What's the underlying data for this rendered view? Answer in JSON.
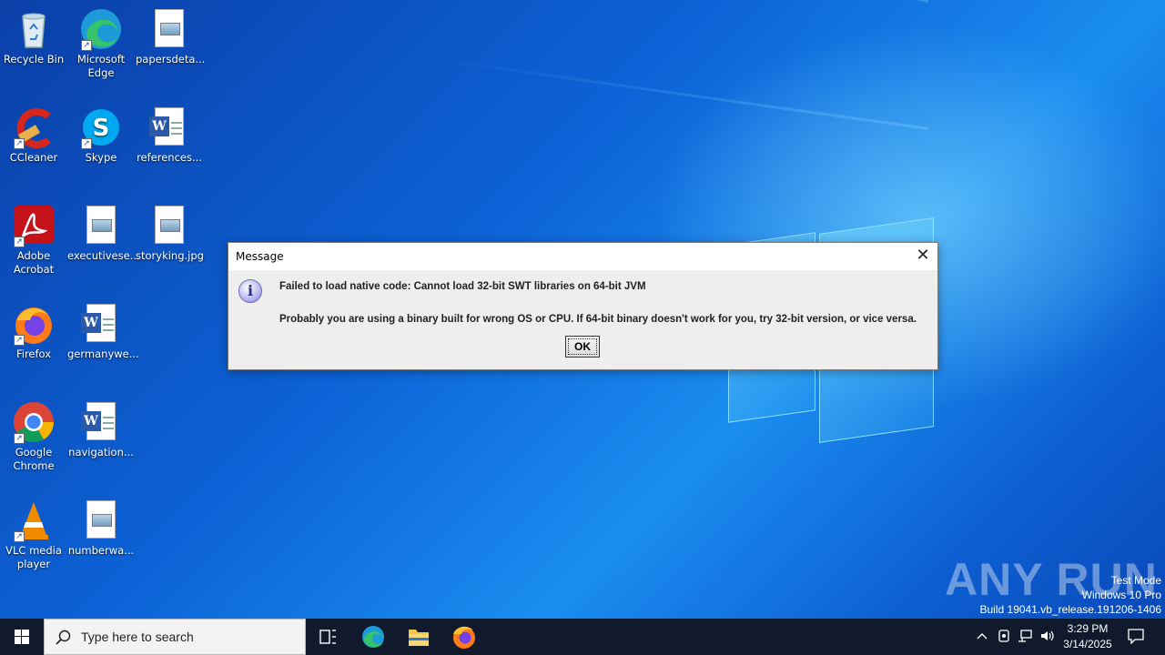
{
  "desktop": {
    "icons": [
      {
        "label": "Recycle Bin",
        "icon": "recycle-bin-icon"
      },
      {
        "label": "Microsoft Edge",
        "icon": "edge-icon"
      },
      {
        "label": "papersdeta...",
        "icon": "image-file-icon"
      },
      {
        "label": "CCleaner",
        "icon": "ccleaner-icon"
      },
      {
        "label": "Skype",
        "icon": "skype-icon"
      },
      {
        "label": "references...",
        "icon": "word-doc-icon"
      },
      {
        "label": "Adobe Acrobat",
        "icon": "acrobat-icon"
      },
      {
        "label": "executivese...",
        "icon": "image-file-icon"
      },
      {
        "label": "storyking.jpg",
        "icon": "image-file-icon"
      },
      {
        "label": "Firefox",
        "icon": "firefox-icon"
      },
      {
        "label": "germanywe...",
        "icon": "word-doc-icon"
      },
      {
        "label": "Google Chrome",
        "icon": "chrome-icon"
      },
      {
        "label": "navigation...",
        "icon": "word-doc-icon"
      },
      {
        "label": "VLC media player",
        "icon": "vlc-icon"
      },
      {
        "label": "numberwa...",
        "icon": "image-file-icon"
      }
    ],
    "watermark": "ANY RUN",
    "test_mode": [
      "Test Mode",
      "Windows 10 Pro",
      "Build 19041.vb_release.191206-1406"
    ]
  },
  "dialog": {
    "title": "Message",
    "close_glyph": "✕",
    "line1": "Failed to load native code: Cannot load 32-bit SWT libraries on 64-bit JVM",
    "line2": "Probably you are using a binary built for wrong OS or CPU. If 64-bit binary doesn't work for you, try 32-bit version, or vice versa.",
    "ok_label": "OK",
    "info_glyph": "i"
  },
  "taskbar": {
    "search_placeholder": "Type here to search",
    "time": "3:29 PM",
    "date": "3/14/2025",
    "colors": {
      "bar": "#101a2c",
      "accent": "#0a5ccf"
    }
  }
}
